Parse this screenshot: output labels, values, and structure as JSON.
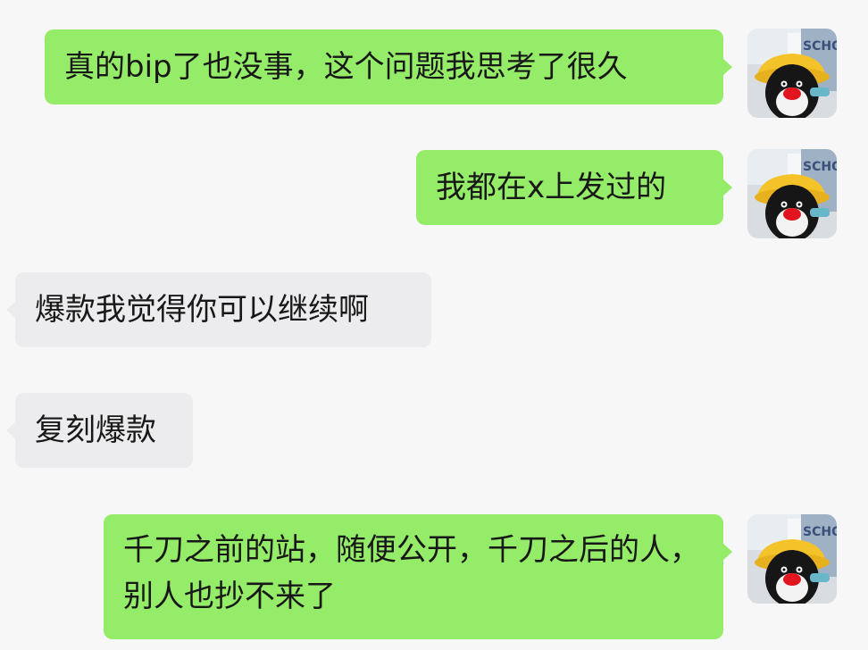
{
  "conversation": {
    "messages": [
      {
        "id": 1,
        "sender": "me",
        "text": "真的bip了也没事，这个问题我思考了很久"
      },
      {
        "id": 2,
        "sender": "me",
        "text": "我都在x上发过的"
      },
      {
        "id": 3,
        "sender": "other",
        "text": "爆款我觉得你可以继续啊"
      },
      {
        "id": 4,
        "sender": "other",
        "text": "复刻爆款"
      },
      {
        "id": 5,
        "sender": "me",
        "text": "千刀之前的站，随便公开，千刀之后的人，别人也抄不来了"
      }
    ],
    "avatar_sign_text": "SCHO"
  },
  "colors": {
    "background": "#f7f7f7",
    "outgoing_bubble": "#95ec69",
    "incoming_bubble": "#ececee",
    "text": "#181818"
  },
  "icons": {
    "avatar": "penguin-avatar-icon"
  }
}
